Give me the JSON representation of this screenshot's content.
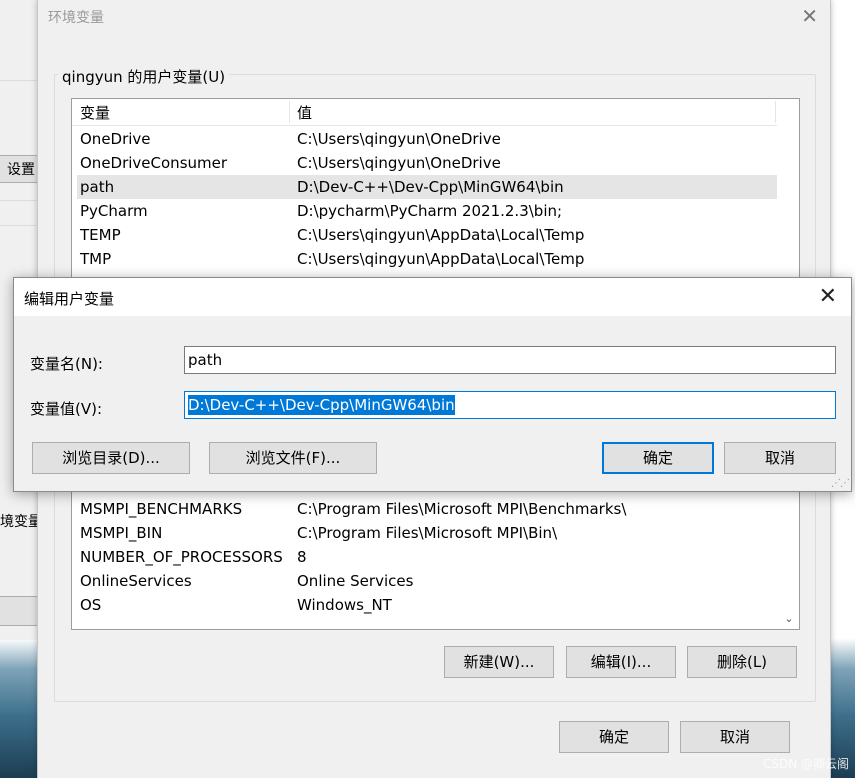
{
  "background_window": {
    "btn_settings": "设置",
    "btn_env": "境变量"
  },
  "env_dialog": {
    "title": "环境变量",
    "close": "✕",
    "group_label": "qingyun 的用户变量(U)",
    "columns": [
      "变量",
      "值"
    ],
    "user_vars_top": [
      {
        "name": "OneDrive",
        "value": "C:\\Users\\qingyun\\OneDrive"
      },
      {
        "name": "OneDriveConsumer",
        "value": "C:\\Users\\qingyun\\OneDrive"
      },
      {
        "name": "path",
        "value": "D:\\Dev-C++\\Dev-Cpp\\MinGW64\\bin",
        "selected": true
      },
      {
        "name": "PyCharm",
        "value": "D:\\pycharm\\PyCharm 2021.2.3\\bin;"
      },
      {
        "name": "TEMP",
        "value": "C:\\Users\\qingyun\\AppData\\Local\\Temp"
      },
      {
        "name": "TMP",
        "value": "C:\\Users\\qingyun\\AppData\\Local\\Temp"
      }
    ],
    "system_vars_visible": [
      {
        "name": "MSMPI_BENCHMARKS",
        "value": "C:\\Program Files\\Microsoft MPI\\Benchmarks\\"
      },
      {
        "name": "MSMPI_BIN",
        "value": "C:\\Program Files\\Microsoft MPI\\Bin\\"
      },
      {
        "name": "NUMBER_OF_PROCESSORS",
        "value": "8"
      },
      {
        "name": "OnlineServices",
        "value": "Online Services"
      },
      {
        "name": "OS",
        "value": "Windows_NT"
      }
    ],
    "buttons": {
      "new": "新建(W)...",
      "edit": "编辑(I)...",
      "delete": "删除(L)",
      "ok": "确定",
      "cancel": "取消"
    }
  },
  "edit_dialog": {
    "title": "编辑用户变量",
    "close": "✕",
    "name_label": "变量名(N):",
    "name_value": "path",
    "value_label": "变量值(V):",
    "value_value": "D:\\Dev-C++\\Dev-Cpp\\MinGW64\\bin",
    "buttons": {
      "browse_dir": "浏览目录(D)...",
      "browse_file": "浏览文件(F)...",
      "ok": "确定",
      "cancel": "取消"
    }
  },
  "watermark": "CSDN @卿云阁"
}
